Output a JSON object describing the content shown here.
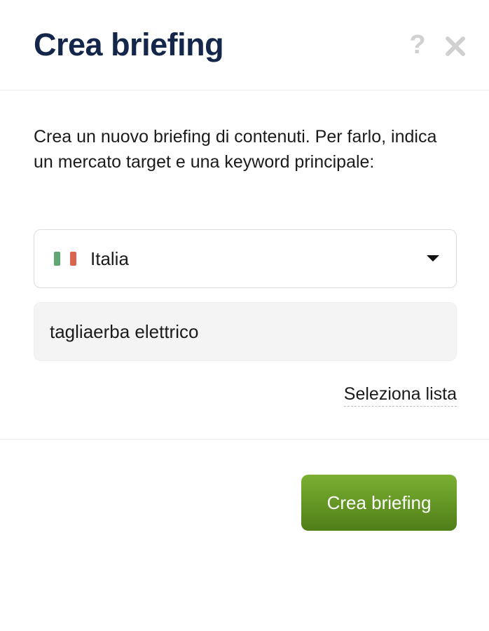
{
  "header": {
    "title": "Crea briefing",
    "help_icon_glyph": "?",
    "help_icon": "question-icon",
    "close_icon": "close-icon"
  },
  "main": {
    "description": "Crea un nuovo briefing di contenuti. Per farlo, indica un mercato target e una keyword principale:",
    "country_select": {
      "selected_value": "Italia",
      "flag_icon": "italy-flag-icon",
      "flag_colors": [
        "#5fa876",
        "#ffffff",
        "#d9654f"
      ]
    },
    "keyword_input": {
      "value": "tagliaerba elettrico"
    },
    "select_list_link": "Seleziona lista"
  },
  "footer": {
    "create_button_label": "Crea briefing"
  },
  "colors": {
    "title": "#14274a",
    "button_gradient_top": "#7bb032",
    "button_gradient_bottom": "#4f7e18",
    "input_background": "#f4f4f4"
  }
}
